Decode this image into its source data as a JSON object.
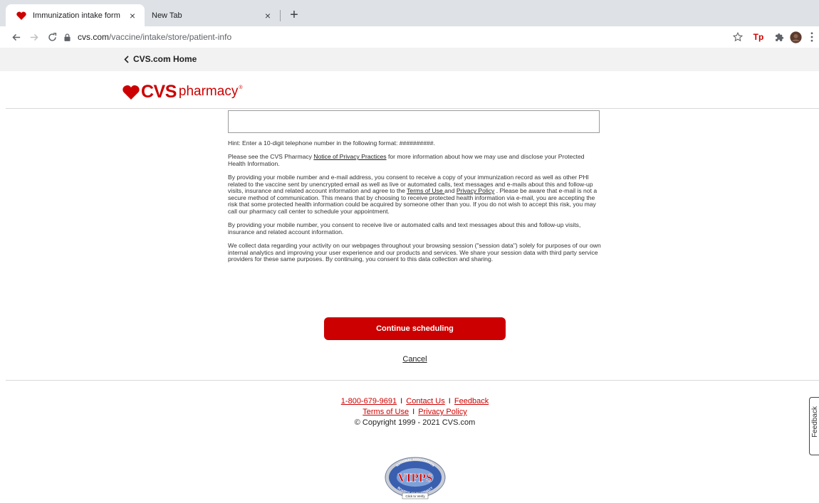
{
  "browser": {
    "tabs": [
      {
        "title": "Immunization intake form",
        "favicon": "heart-icon",
        "active": true
      },
      {
        "title": "New Tab",
        "favicon": "",
        "active": false
      }
    ],
    "new_tab_symbol": "+",
    "url_host": "cvs.com",
    "url_path": "/vaccine/intake/store/patient-info",
    "toolbar_icons": [
      "bookmark-star-icon",
      "tp-extension-icon",
      "extensions-puzzle-icon",
      "profile-avatar-icon",
      "menu-kebab-icon"
    ],
    "tp_label": "Tp"
  },
  "header": {
    "home_link": "CVS.com Home",
    "logo": {
      "brand": "CVS",
      "sub": "pharmacy",
      "mark": "®",
      "color": "#cc0000"
    }
  },
  "form": {
    "phone_value": "",
    "phone_placeholder": "",
    "hint": "Hint: Enter a 10-digit telephone number in the following format: ##########.",
    "privacy_para": {
      "before": "Please see the CVS Pharmacy ",
      "link": "Notice of Privacy Practices",
      "after": " for more information about how we may use and disclose your Protected Health Information."
    },
    "consent_para": {
      "part1": "By providing your mobile number and e-mail address, you consent to receive a copy of your immunization record as well as other PHI related to the vaccine sent by unencrypted email as well as live or automated calls, text messages and e-mails about this and follow-up visits, insurance and related account information and agree to the ",
      "terms_link": "Terms of Use ",
      "and": "and ",
      "privacy_link": "Privacy Policy",
      "part2": " . Please be aware that e-mail is not a secure method of communication. This means that by choosing to receive protected health information via e-mail, you are accepting the risk that some protected health information could be acquired by someone other than you. If you do not wish to accept this risk, you may call our pharmacy call center to schedule your appointment."
    },
    "mobile_para": "By providing your mobile number, you consent to receive live or automated calls and text messages about this and follow-up visits, insurance and related account information.",
    "session_para": "We collect data regarding your activity on our webpages throughout your browsing session (\"session data\") solely for purposes of our own internal analytics and improving your user experience and our products and services. We share your session data with third party service providers for these same purposes. By continuing, you consent to this data collection and sharing.",
    "continue_label": "Continue scheduling",
    "cancel_label": "Cancel"
  },
  "footer": {
    "phone": "1-800-679-9691",
    "contact": "Contact Us",
    "feedback": "Feedback",
    "terms": "Terms of Use",
    "privacy": "Privacy Policy",
    "separator": "I",
    "copyright": "© Copyright 1999 - 2021 CVS.com"
  },
  "vipps": {
    "top_text": "NATIONAL ASSOCIATION",
    "main": "VIPPS",
    "bottom_text": "BOARDS OF PHARMACY",
    "verify": "Click to Verify"
  },
  "feedback_tab": "Feedback",
  "colors": {
    "accent": "#cc0000",
    "tabstrip": "#dee1e6",
    "homebar": "#f2f2f2"
  }
}
